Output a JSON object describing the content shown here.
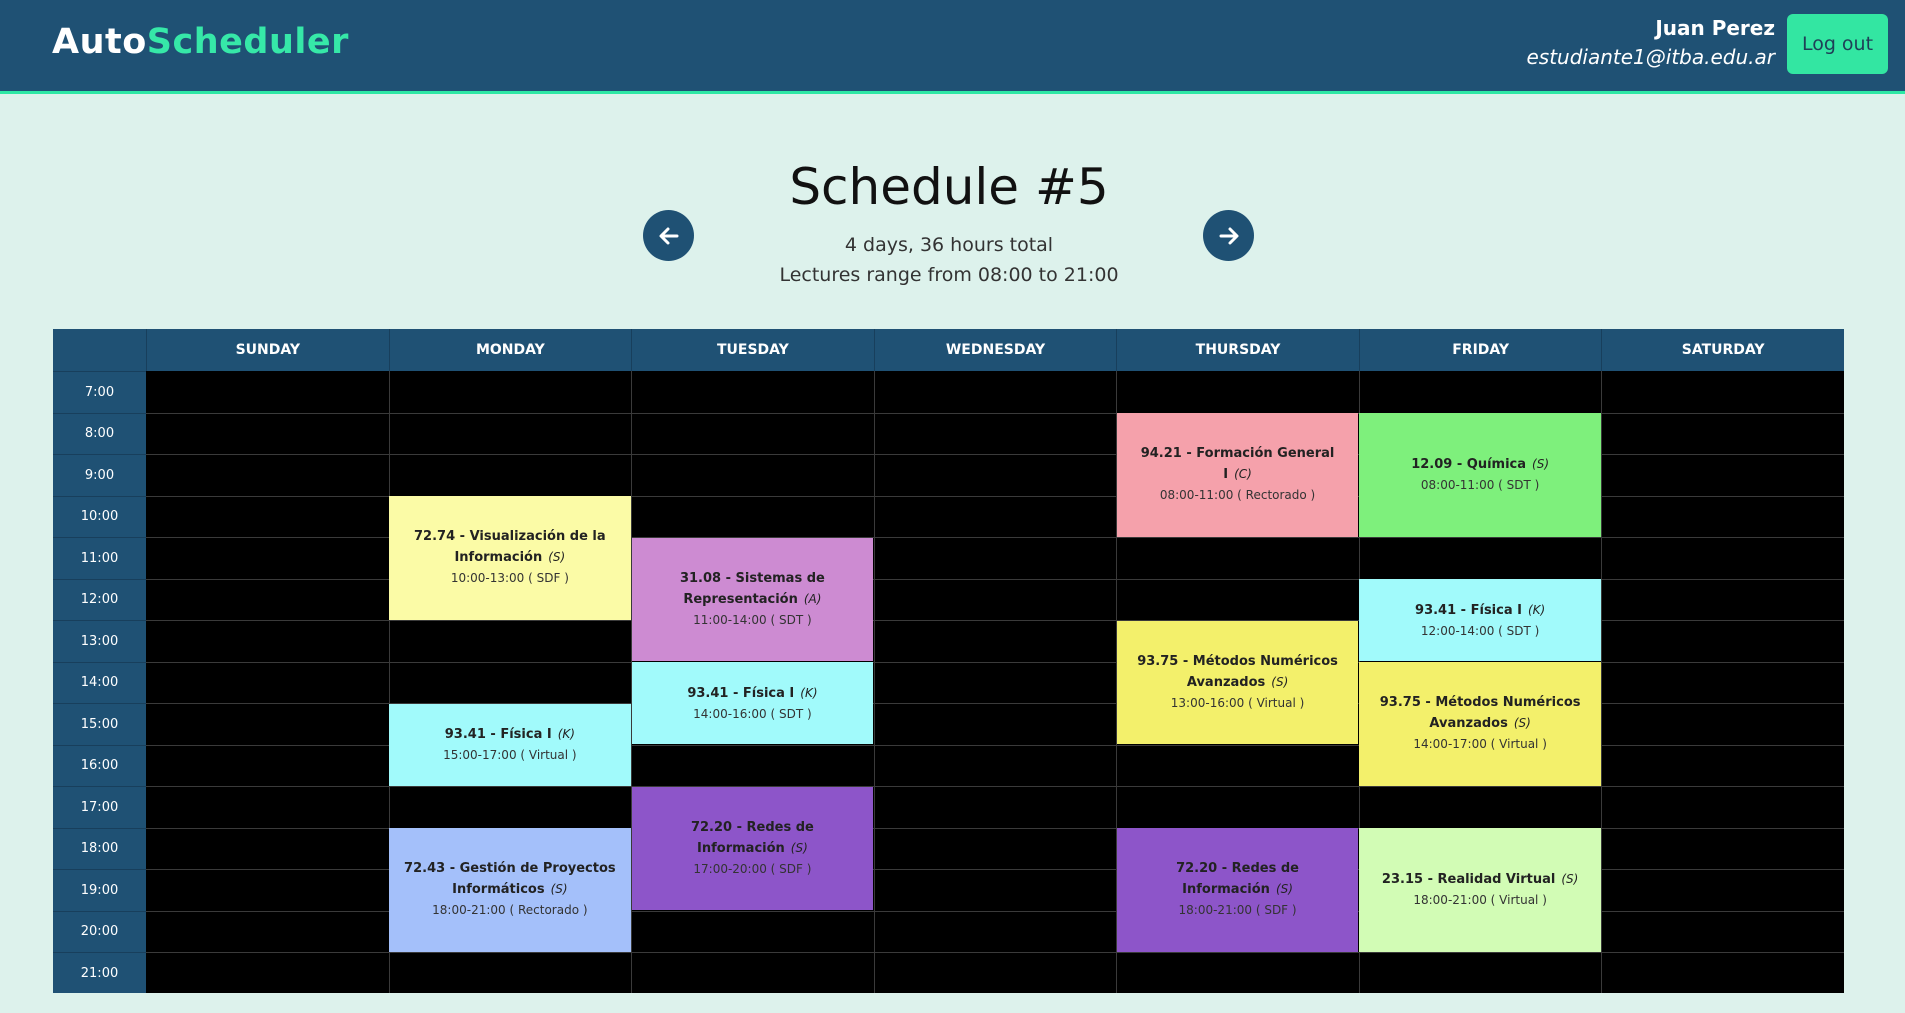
{
  "header": {
    "logo_part1": "Auto",
    "logo_part2": "Scheduler",
    "user_name": "Juan Perez",
    "user_email": "estudiante1@itba.edu.ar",
    "logout_label": "Log out"
  },
  "summary": {
    "title": "Schedule #5",
    "line1": "4 days, 36 hours total",
    "line2": "Lectures range from 08:00 to 21:00"
  },
  "calendar": {
    "days": [
      "SUNDAY",
      "MONDAY",
      "TUESDAY",
      "WEDNESDAY",
      "THURSDAY",
      "FRIDAY",
      "SATURDAY"
    ],
    "hours": [
      "7:00",
      "8:00",
      "9:00",
      "10:00",
      "11:00",
      "12:00",
      "13:00",
      "14:00",
      "15:00",
      "16:00",
      "17:00",
      "18:00",
      "19:00",
      "20:00",
      "21:00"
    ],
    "events": [
      {
        "day": 4,
        "start": 8,
        "end": 11,
        "code": "94.21",
        "name": "Formación General I",
        "type": "(C)",
        "detail": "08:00-11:00 ( Rectorado )",
        "color": "#f5a1ab"
      },
      {
        "day": 5,
        "start": 8,
        "end": 11,
        "code": "12.09",
        "name": "Química",
        "type": "(S)",
        "detail": "08:00-11:00 ( SDT )",
        "color": "#7ef07c"
      },
      {
        "day": 1,
        "start": 10,
        "end": 13,
        "code": "72.74",
        "name": "Visualización de la Información",
        "type": "(S)",
        "detail": "10:00-13:00 ( SDF )",
        "color": "#fbfba6"
      },
      {
        "day": 2,
        "start": 11,
        "end": 14,
        "code": "31.08",
        "name": "Sistemas de Representación",
        "type": "(A)",
        "detail": "11:00-14:00 ( SDT )",
        "color": "#cd8bd2"
      },
      {
        "day": 5,
        "start": 12,
        "end": 14,
        "code": "93.41",
        "name": "Física I",
        "type": "(K)",
        "detail": "12:00-14:00 ( SDT )",
        "color": "#a1fafb"
      },
      {
        "day": 4,
        "start": 13,
        "end": 16,
        "code": "93.75",
        "name": "Métodos Numéricos Avanzados",
        "type": "(S)",
        "detail": "13:00-16:00 ( Virtual )",
        "color": "#f3f06b"
      },
      {
        "day": 2,
        "start": 14,
        "end": 16,
        "code": "93.41",
        "name": "Física I",
        "type": "(K)",
        "detail": "14:00-16:00 ( SDT )",
        "color": "#a1fafb"
      },
      {
        "day": 5,
        "start": 14,
        "end": 17,
        "code": "93.75",
        "name": "Métodos Numéricos Avanzados",
        "type": "(S)",
        "detail": "14:00-17:00 ( Virtual )",
        "color": "#f3f06b"
      },
      {
        "day": 1,
        "start": 15,
        "end": 17,
        "code": "93.41",
        "name": "Física I",
        "type": "(K)",
        "detail": "15:00-17:00 ( Virtual )",
        "color": "#a1fafb"
      },
      {
        "day": 2,
        "start": 17,
        "end": 20,
        "code": "72.20",
        "name": "Redes de Información",
        "type": "(S)",
        "detail": "17:00-20:00 ( SDF )",
        "color": "#8d55c9"
      },
      {
        "day": 1,
        "start": 18,
        "end": 21,
        "code": "72.43",
        "name": "Gestión de Proyectos Informáticos",
        "type": "(S)",
        "detail": "18:00-21:00 ( Rectorado )",
        "color": "#a4c0fa"
      },
      {
        "day": 4,
        "start": 18,
        "end": 21,
        "code": "72.20",
        "name": "Redes de Información",
        "type": "(S)",
        "detail": "18:00-21:00 ( SDF )",
        "color": "#8d55c9"
      },
      {
        "day": 5,
        "start": 18,
        "end": 21,
        "code": "23.15",
        "name": "Realidad Virtual",
        "type": "(S)",
        "detail": "18:00-21:00 ( Virtual )",
        "color": "#d2fcb5"
      }
    ]
  }
}
